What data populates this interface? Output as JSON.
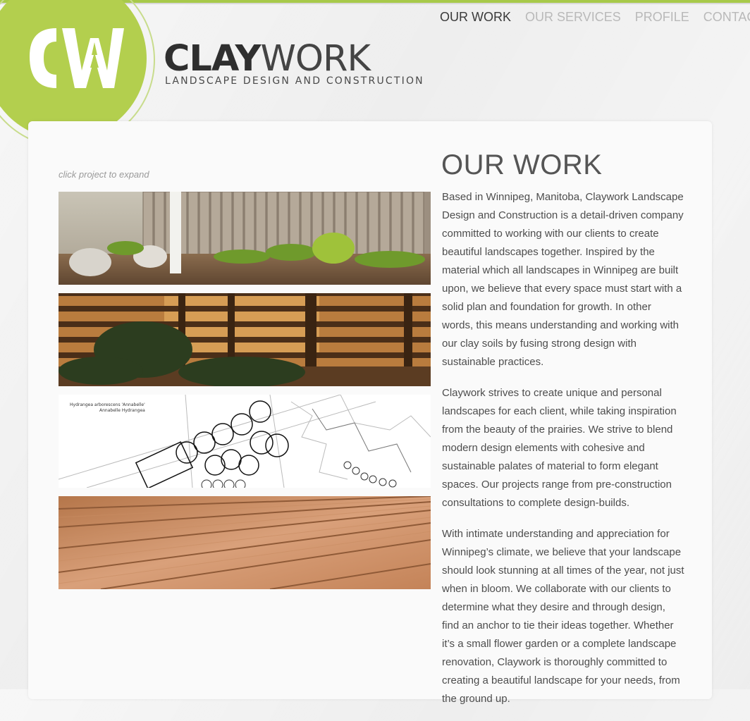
{
  "brand": {
    "monogram": "CW",
    "name_bold": "CLAY",
    "name_thin": "WORK",
    "tagline": "LANDSCAPE DESIGN AND CONSTRUCTION"
  },
  "nav": {
    "items": [
      {
        "label": "OUR WORK",
        "active": true
      },
      {
        "label": "OUR SERVICES",
        "active": false
      },
      {
        "label": "PROFILE",
        "active": false
      },
      {
        "label": "CONTACT",
        "active": false
      }
    ]
  },
  "gallery": {
    "hint": "click project to expand",
    "drawing_label_1": "Hydrangea arborescens 'Annabelle'",
    "drawing_label_2": "Annabelle Hydrangea"
  },
  "content": {
    "heading": "OUR WORK",
    "paragraphs": [
      "Based in Winnipeg, Manitoba, Claywork Landscape Design and Construction is a detail-driven company committed to working with our clients to create beautiful landscapes together. Inspired by the material which all landscapes in Winnipeg are built upon, we believe that every space must start with a solid plan and foundation for growth. In other words, this means understanding and working with our clay soils by fusing strong design with sustainable practices.",
      "Claywork strives to create unique and personal landscapes for each client, while taking inspiration from the beauty of the prairies. We strive to blend modern design elements with cohesive and sustainable palates of material to form elegant spaces. Our projects range from pre-construction consultations to complete design-builds.",
      "With intimate understanding and appreciation for Winnipeg’s climate, we believe that your landscape should look stunning at all times of the year, not just when in bloom. We collaborate with our clients to determine what they desire and through design, find an anchor to tie their ideas together. Whether it’s a small flower garden or a complete landscape renovation, Claywork is thoroughly committed to creating a beautiful landscape for your needs, from the ground up."
    ]
  },
  "colors": {
    "accent": "#b3cf4e",
    "text": "#4d4d4d",
    "nav_active": "#3a3a3a",
    "nav_inactive": "#b9b9b9"
  }
}
